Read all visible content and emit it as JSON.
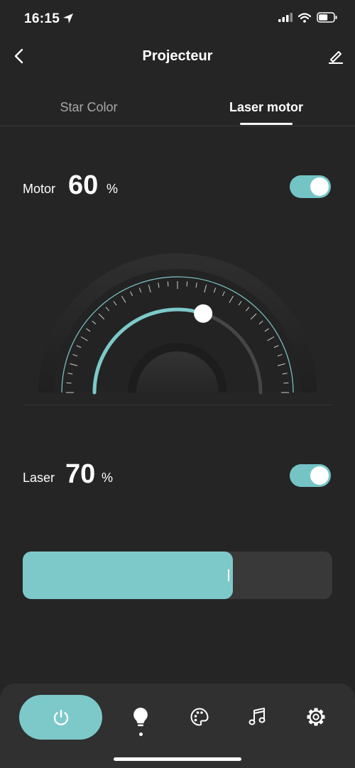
{
  "status": {
    "time": "16:15"
  },
  "nav": {
    "title": "Projecteur"
  },
  "tabs": [
    {
      "label": "Star Color",
      "active": false
    },
    {
      "label": "Laser motor",
      "active": true
    }
  ],
  "motor": {
    "label": "Motor",
    "value": "60",
    "unit": "%",
    "level": 0.6,
    "enabled": true
  },
  "laser": {
    "label": "Laser",
    "value": "70",
    "unit": "%",
    "level": 0.68,
    "enabled": true
  },
  "bottom_nav": {
    "items": [
      "power-icon",
      "bulb-icon",
      "palette-icon",
      "music-note-icon",
      "gear-icon"
    ],
    "active": "bulb-icon"
  },
  "colors": {
    "accent": "#7dc9ca",
    "background": "#252525",
    "bar": "#303030"
  }
}
